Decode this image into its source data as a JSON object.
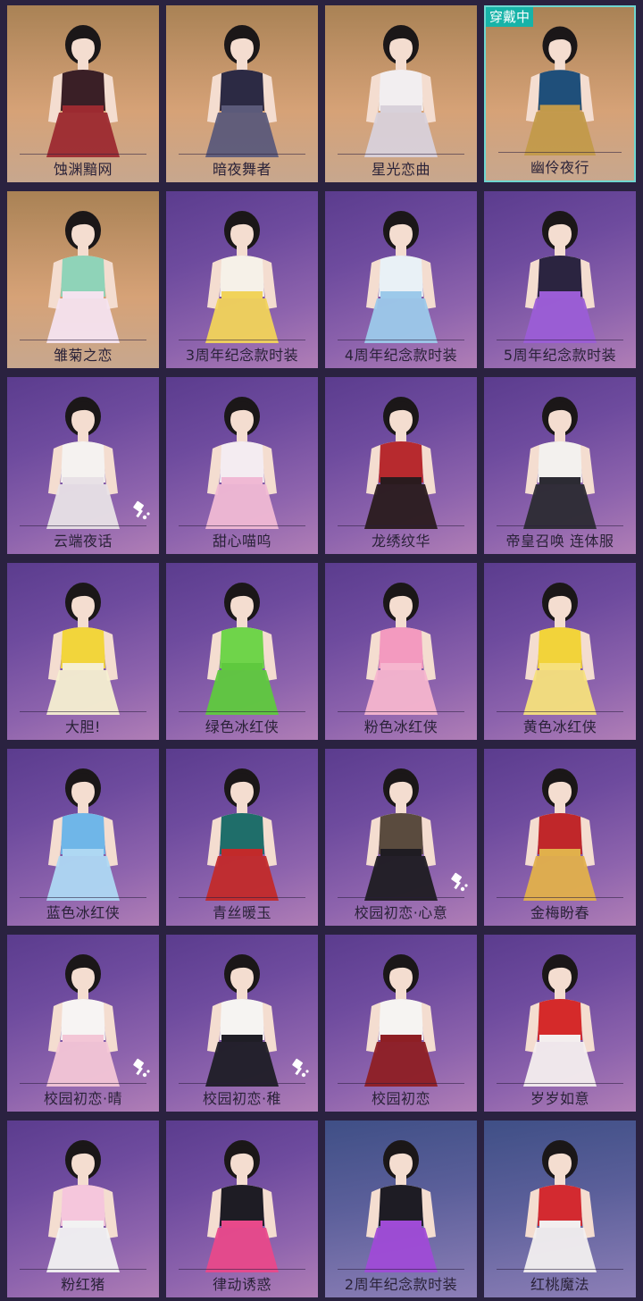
{
  "badge_label": "穿戴中",
  "colors": {
    "badge": "#17b3a8",
    "selected_border": "#6fd6d0",
    "background": "#2a2240"
  },
  "costumes": [
    {
      "name": "蚀渊黯网",
      "bg": "gold",
      "outfit": "#3a1f26",
      "accent": "#9c2a30"
    },
    {
      "name": "暗夜舞者",
      "bg": "gold",
      "outfit": "#2c2a44",
      "accent": "#5b5a7a"
    },
    {
      "name": "星光恋曲",
      "bg": "gold",
      "outfit": "#f2eef0",
      "accent": "#d8d1da"
    },
    {
      "name": "幽伶夜行",
      "bg": "gold",
      "outfit": "#1f4f7a",
      "accent": "#c29a4a",
      "selected": true
    },
    {
      "name": "雏菊之恋",
      "bg": "gold",
      "outfit": "#8fd3b8",
      "accent": "#f4e3ef"
    },
    {
      "name": "3周年纪念款时装",
      "bg": "purple",
      "outfit": "#f6f1e8",
      "accent": "#f1d35a"
    },
    {
      "name": "4周年纪念款时装",
      "bg": "purple",
      "outfit": "#e9f1f6",
      "accent": "#9cc9ea"
    },
    {
      "name": "5周年纪念款时装",
      "bg": "purple",
      "outfit": "#2b2440",
      "accent": "#9b5dd6"
    },
    {
      "name": "云端夜话",
      "bg": "purple",
      "outfit": "#f5f2f0",
      "accent": "#e8e1e6",
      "dye": true
    },
    {
      "name": "甜心喵呜",
      "bg": "purple",
      "outfit": "#f4ecf1",
      "accent": "#f0b9d4"
    },
    {
      "name": "龙绣纹华",
      "bg": "purple",
      "outfit": "#b72a2e",
      "accent": "#2a1b1e"
    },
    {
      "name": "帝皇召唤 连体服",
      "bg": "purple",
      "outfit": "#f3f1ee",
      "accent": "#2c2b33"
    },
    {
      "name": "大胆!",
      "bg": "purple",
      "outfit": "#f2d53b",
      "accent": "#f6efd1"
    },
    {
      "name": "绿色冰红侠",
      "bg": "purple",
      "outfit": "#6fd44a",
      "accent": "#5fc93e"
    },
    {
      "name": "粉色冰红侠",
      "bg": "purple",
      "outfit": "#f39abf",
      "accent": "#f6b5ce"
    },
    {
      "name": "黄色冰红侠",
      "bg": "purple",
      "outfit": "#f2d33a",
      "accent": "#f6e07c"
    },
    {
      "name": "蓝色冰红侠",
      "bg": "purple",
      "outfit": "#6fb6e8",
      "accent": "#aed8f3"
    },
    {
      "name": "青丝暖玉",
      "bg": "purple",
      "outfit": "#1f6e6a",
      "accent": "#c22a2a"
    },
    {
      "name": "校园初恋·心意",
      "bg": "purple",
      "outfit": "#5a4b3e",
      "accent": "#1f1c22",
      "dye": true
    },
    {
      "name": "金梅盼春",
      "bg": "purple",
      "outfit": "#c0272a",
      "accent": "#e1b04b"
    },
    {
      "name": "校园初恋·晴",
      "bg": "purple",
      "outfit": "#f7f4f3",
      "accent": "#f3c6d6",
      "dye": true
    },
    {
      "name": "校园初恋·稚",
      "bg": "purple",
      "outfit": "#f6f4f2",
      "accent": "#1f1e26",
      "dye": true
    },
    {
      "name": "校园初恋",
      "bg": "purple",
      "outfit": "#f6f4f2",
      "accent": "#8e1f24"
    },
    {
      "name": "岁岁如意",
      "bg": "purple",
      "outfit": "#d52a2a",
      "accent": "#f4eeee"
    },
    {
      "name": "粉红猪",
      "bg": "purple",
      "outfit": "#f5c6dc",
      "accent": "#f2f2f2"
    },
    {
      "name": "律动诱惑",
      "bg": "purple",
      "outfit": "#1e1c24",
      "accent": "#e8498a"
    },
    {
      "name": "2周年纪念款时装",
      "bg": "blue",
      "outfit": "#1e1c24",
      "accent": "#9f4bd6"
    },
    {
      "name": "红桃魔法",
      "bg": "blue",
      "outfit": "#d32a30",
      "accent": "#f2efef"
    }
  ]
}
